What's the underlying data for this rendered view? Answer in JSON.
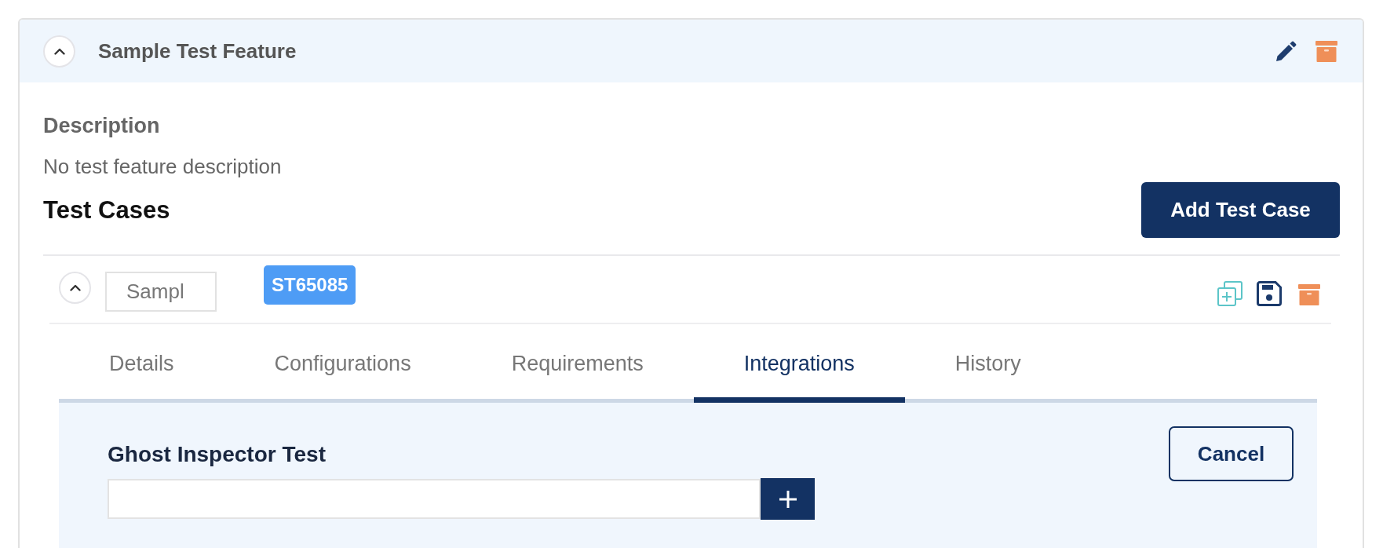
{
  "feature": {
    "title": "Sample Test Feature",
    "expanded": true
  },
  "description": {
    "heading": "Description",
    "text": "No test feature description"
  },
  "test_cases": {
    "heading": "Test Cases",
    "add_button": "Add Test Case",
    "items": [
      {
        "name": "Sampl",
        "expanded": true,
        "badge": "ST65085",
        "tabs": [
          {
            "label": "Details",
            "selected": false
          },
          {
            "label": "Configurations",
            "selected": false
          },
          {
            "label": "Requirements",
            "selected": false
          },
          {
            "label": "Integrations",
            "selected": true
          },
          {
            "label": "History",
            "selected": false
          }
        ],
        "integration": {
          "label": "Ghost Inspector Test",
          "cancel_button": "Cancel"
        }
      }
    ]
  }
}
